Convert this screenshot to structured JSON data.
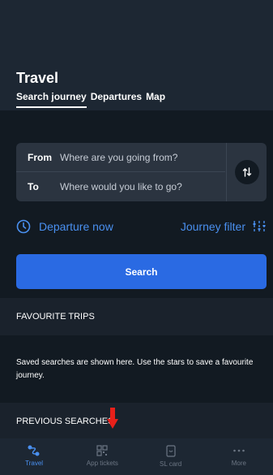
{
  "header": {
    "title": "Travel",
    "tabs": [
      {
        "label": "Search journey",
        "active": true
      },
      {
        "label": "Departures",
        "active": false
      },
      {
        "label": "Map",
        "active": false
      }
    ]
  },
  "form": {
    "from_label": "From",
    "from_placeholder": "Where are you going from?",
    "to_label": "To",
    "to_placeholder": "Where would you like to go?",
    "swap_icon": "swap-arrows-icon"
  },
  "options": {
    "departure": "Departure now",
    "departure_icon": "clock-icon",
    "filter": "Journey filter",
    "filter_icon": "filter-sliders-icon"
  },
  "search_button": "Search",
  "favourites": {
    "heading": "FAVOURITE TRIPS",
    "text": "Saved searches are shown here. Use the stars to save a favourite journey."
  },
  "previous": {
    "heading": "PREVIOUS SEARCHES"
  },
  "nav": [
    {
      "label": "Travel",
      "icon": "travel-icon",
      "active": true
    },
    {
      "label": "App tickets",
      "icon": "qr-code-icon",
      "active": false
    },
    {
      "label": "SL card",
      "icon": "card-icon",
      "active": false
    },
    {
      "label": "More",
      "icon": "more-dots-icon",
      "active": false
    }
  ],
  "colors": {
    "accent": "#2a6ae3",
    "link": "#4a90f0",
    "background": "#121a22",
    "annotation_arrow": "#e8201a"
  }
}
